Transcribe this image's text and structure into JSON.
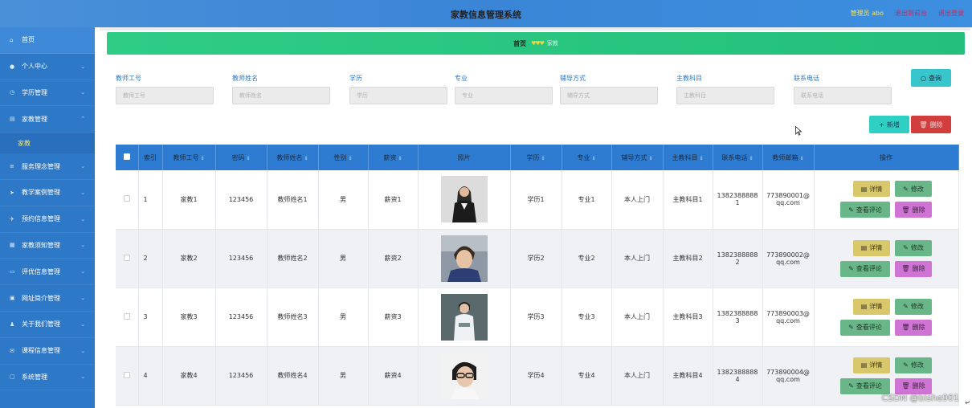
{
  "header": {
    "title": "家教信息管理系统",
    "admin": "管理员 abo",
    "back_link": "退出到前台",
    "logout_link": "退出登录"
  },
  "sidebar": {
    "items": [
      {
        "label": "首页",
        "icon": "home-icon"
      },
      {
        "label": "个人中心",
        "icon": "user-icon"
      },
      {
        "label": "学历管理",
        "icon": "clock-icon"
      },
      {
        "label": "家教管理",
        "icon": "document-icon",
        "sub": [
          "家教"
        ]
      },
      {
        "label": "服务理念管理",
        "icon": "list-icon"
      },
      {
        "label": "教学案例管理",
        "icon": "send-icon"
      },
      {
        "label": "预约信息管理",
        "icon": "paper-plane-icon"
      },
      {
        "label": "家教须知管理",
        "icon": "server-icon"
      },
      {
        "label": "评优信息管理",
        "icon": "card-icon"
      },
      {
        "label": "网址简介管理",
        "icon": "monitor-icon"
      },
      {
        "label": "关于我们管理",
        "icon": "person-icon"
      },
      {
        "label": "课程信息管理",
        "icon": "mail-icon"
      },
      {
        "label": "系统管理",
        "icon": "window-icon"
      }
    ]
  },
  "breadcrumb": {
    "home": "首页",
    "separator": "♥♥♥",
    "current": "家教"
  },
  "search": {
    "fields": [
      {
        "label": "教师工号",
        "placeholder": "教师工号"
      },
      {
        "label": "教师姓名",
        "placeholder": "教师姓名"
      },
      {
        "label": "学历",
        "placeholder": "学历"
      },
      {
        "label": "专业",
        "placeholder": "专业"
      },
      {
        "label": "辅导方式",
        "placeholder": "辅导方式"
      },
      {
        "label": "主教科目",
        "placeholder": "主教科目"
      },
      {
        "label": "联系电话",
        "placeholder": "联系电话"
      }
    ],
    "query_button": "查询"
  },
  "actions": {
    "add_button": "新增",
    "delete_button": "删除"
  },
  "table": {
    "headers": [
      "索引",
      "教师工号",
      "密码",
      "教师姓名",
      "性别",
      "薪资",
      "照片",
      "学历",
      "专业",
      "辅导方式",
      "主教科目",
      "联系电话",
      "教师邮箱",
      "操作"
    ],
    "rows": [
      {
        "index": "1",
        "id": "家教1",
        "password": "123456",
        "name": "教师姓名1",
        "gender": "男",
        "salary": "薪资1",
        "edu": "学历1",
        "major": "专业1",
        "method": "本人上门",
        "subject": "主教科目1",
        "phone_a": "1382388888",
        "phone_b": "1",
        "email_a": "773890001@",
        "email_b": "qq.com"
      },
      {
        "index": "2",
        "id": "家教2",
        "password": "123456",
        "name": "教师姓名2",
        "gender": "男",
        "salary": "薪资2",
        "edu": "学历2",
        "major": "专业2",
        "method": "本人上门",
        "subject": "主教科目2",
        "phone_a": "1382388888",
        "phone_b": "2",
        "email_a": "773890002@",
        "email_b": "qq.com"
      },
      {
        "index": "3",
        "id": "家教3",
        "password": "123456",
        "name": "教师姓名3",
        "gender": "男",
        "salary": "薪资3",
        "edu": "学历3",
        "major": "专业3",
        "method": "本人上门",
        "subject": "主教科目3",
        "phone_a": "1382388888",
        "phone_b": "3",
        "email_a": "773890003@",
        "email_b": "qq.com"
      },
      {
        "index": "4",
        "id": "家教4",
        "password": "123456",
        "name": "教师姓名4",
        "gender": "男",
        "salary": "薪资4",
        "edu": "学历4",
        "major": "专业4",
        "method": "本人上门",
        "subject": "主教科目4",
        "phone_a": "1382388888",
        "phone_b": "4",
        "email_a": "773890004@",
        "email_b": "qq.com"
      }
    ],
    "ops": {
      "detail": "详情",
      "edit": "修改",
      "review": "查看评论",
      "delete": "删除"
    }
  },
  "watermark": "CSDN @bishe901",
  "colors": {
    "header": "#3a85d6",
    "sidebar": "#2e78c8",
    "banner": "#2fcc86",
    "table_header": "#2e7cd2"
  }
}
